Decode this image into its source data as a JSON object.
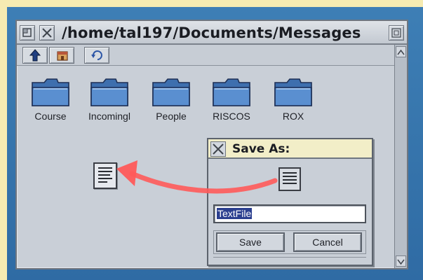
{
  "window": {
    "title": "/home/tal197/Documents/Messages"
  },
  "toolbar": {
    "buttons": [
      {
        "icon": "up-arrow-icon"
      },
      {
        "icon": "home-icon"
      },
      {
        "icon": "refresh-icon"
      }
    ]
  },
  "folders": [
    {
      "label": "Course"
    },
    {
      "label": "Incomingl"
    },
    {
      "label": "People"
    },
    {
      "label": "RISCOS"
    },
    {
      "label": "ROX"
    }
  ],
  "save_dialog": {
    "title": "Save As:",
    "filename": "TextFile",
    "save_label": "Save",
    "cancel_label": "Cancel"
  },
  "colors": {
    "folder_blue": "#4f86c6",
    "drag_arrow": "#ff5a5a",
    "selection": "#2b3f8f"
  }
}
